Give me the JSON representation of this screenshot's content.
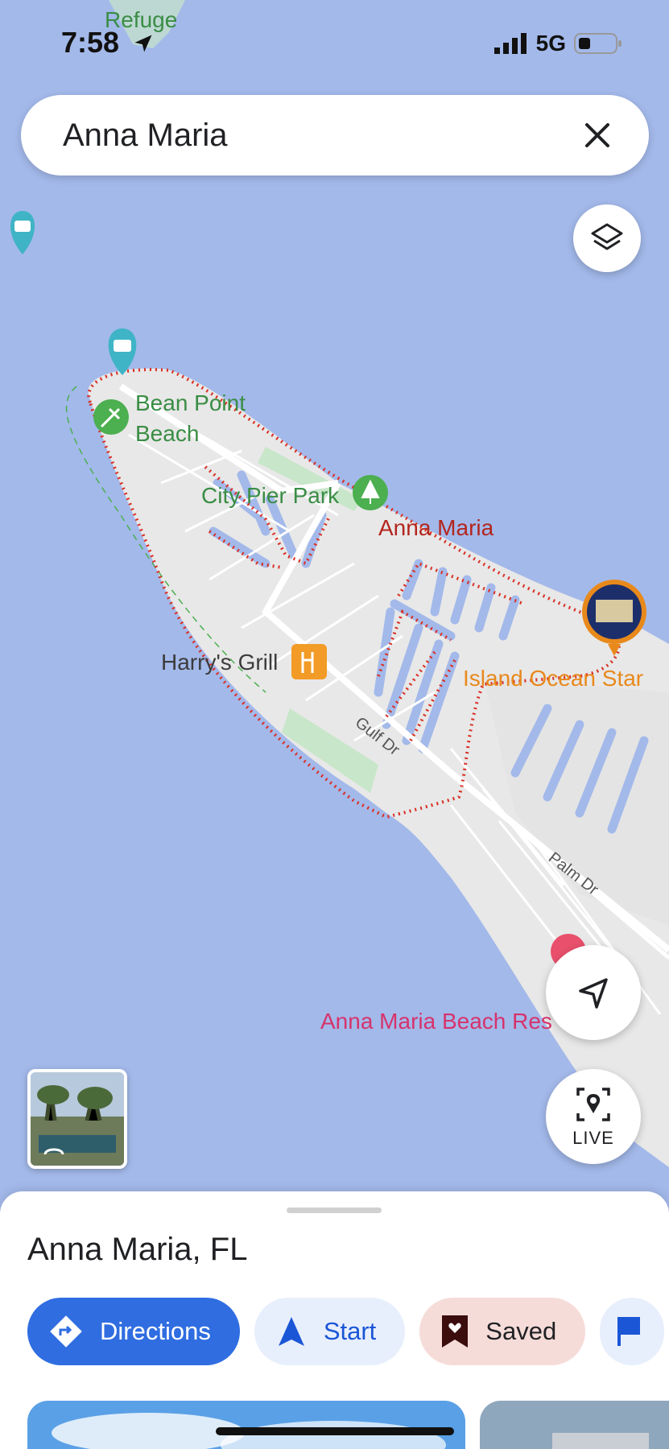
{
  "status": {
    "time": "7:58",
    "network": "5G"
  },
  "search": {
    "query": "Anna Maria"
  },
  "map": {
    "labels": {
      "refuge": "Refuge",
      "bean_point_line1": "Bean Point",
      "bean_point_line2": "Beach",
      "city_pier_park": "City Pier Park",
      "anna_maria": "Anna Maria",
      "harrys_grill": "Harry's Grill",
      "island_ocean_star": "Island Ocean Star",
      "gulf_dr": "Gulf Dr",
      "palm_dr": "Palm Dr",
      "beach_resort": "Anna Maria Beach Res"
    },
    "colors": {
      "water": "#a3b9ea",
      "land": "#e8e8e8",
      "park": "#c8e6c9",
      "boundary": "#d93025"
    }
  },
  "buttons": {
    "live_label": "LIVE"
  },
  "icons": {
    "layers": "layers-icon",
    "navigate": "navigation-arrow-icon",
    "live": "live-view-icon",
    "close": "close-icon",
    "directions": "directions-icon",
    "start": "navigation-icon",
    "saved": "bookmark-heart-icon"
  },
  "place": {
    "title": "Anna Maria, FL",
    "actions": {
      "directions": "Directions",
      "start": "Start",
      "saved": "Saved"
    }
  },
  "accent_colors": {
    "primary": "#2f6de1",
    "saved_bg": "#f6dcd9"
  }
}
